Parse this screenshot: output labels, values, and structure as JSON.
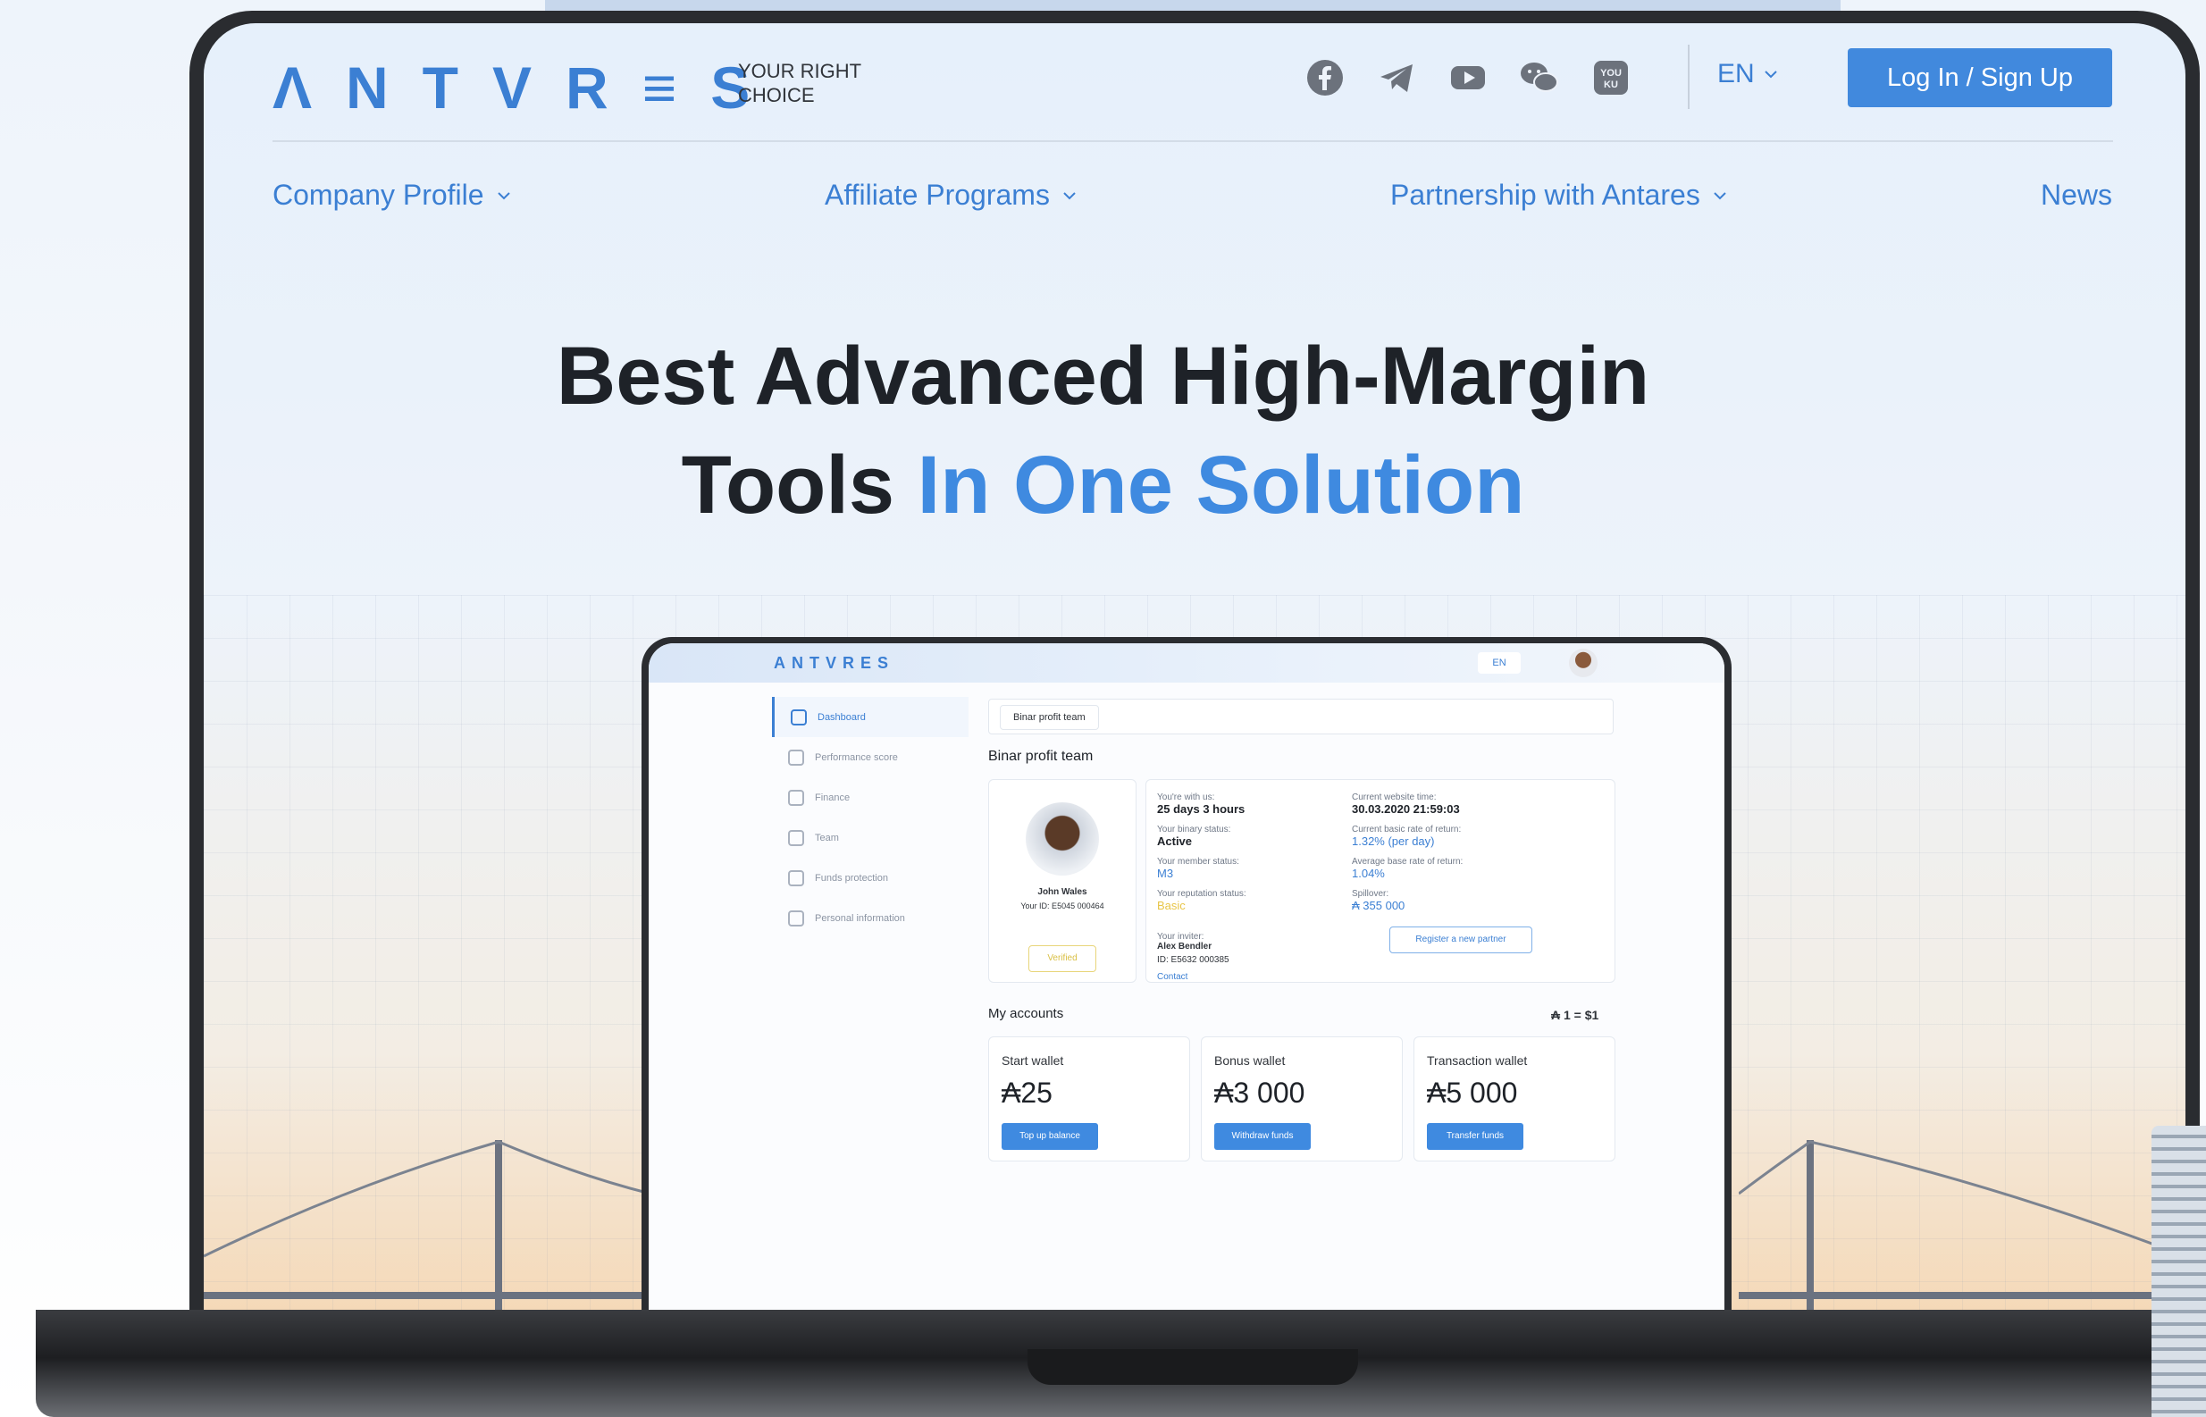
{
  "header": {
    "logo": "ΛNTVR≡S",
    "tagline": "YOUR RIGHT CHOICE",
    "social_icons": [
      "facebook-icon",
      "telegram-icon",
      "youtube-icon",
      "wechat-icon",
      "youku-icon"
    ],
    "language": "EN",
    "login_label": "Log In / Sign Up"
  },
  "nav": {
    "items": [
      {
        "label": "Company Profile",
        "has_dropdown": true
      },
      {
        "label": "Affiliate Programs",
        "has_dropdown": true
      },
      {
        "label": "Partnership with Antares",
        "has_dropdown": true
      },
      {
        "label": "News",
        "has_dropdown": false
      }
    ]
  },
  "hero": {
    "line1": "Best Advanced High-Margin",
    "line2_plain": "Tools",
    "line2_accent": "In One Solution"
  },
  "dashboard": {
    "logo": "ANTVRES",
    "language": "EN",
    "sidebar": [
      {
        "label": "Dashboard",
        "active": true
      },
      {
        "label": "Performance score"
      },
      {
        "label": "Finance"
      },
      {
        "label": "Team"
      },
      {
        "label": "Funds protection"
      },
      {
        "label": "Personal information"
      }
    ],
    "tab": "Binar profit team",
    "section_title": "Binar profit team",
    "profile": {
      "name": "John Wales",
      "id_line": "Your ID: E5045 000464",
      "badge": "Verified"
    },
    "stats_left": [
      {
        "label": "You're with us:",
        "value": "25 days 3 hours"
      },
      {
        "label": "Your binary status:",
        "value": "Active"
      },
      {
        "label": "Your member status:",
        "value": "M3"
      },
      {
        "label": "Your reputation status:",
        "value": "Basic"
      }
    ],
    "stats_right": [
      {
        "label": "Current website time:",
        "value": "30.03.2020 21:59:03"
      },
      {
        "label": "Current basic rate of return:",
        "value": "1.32% (per day)"
      },
      {
        "label": "Average base rate of return:",
        "value": "1.04%"
      },
      {
        "label": "Spillover:",
        "value": "₳ 355 000"
      }
    ],
    "inviter": {
      "label": "Your inviter:",
      "name": "Alex Bendler",
      "id": "ID: E5632 000385",
      "contact": "Contact"
    },
    "register_button": "Register a new partner",
    "accounts_title": "My accounts",
    "rate": "₳ 1 = $1",
    "wallets": [
      {
        "title": "Start wallet",
        "value": "₳25",
        "button": "Top up balance"
      },
      {
        "title": "Bonus wallet",
        "value": "₳3 000",
        "button": "Withdraw funds"
      },
      {
        "title": "Transaction wallet",
        "value": "₳5 000",
        "button": "Transfer funds"
      }
    ]
  },
  "colors": {
    "accent": "#3f8ae0",
    "text_dark": "#1e2228",
    "laptop": "#2a2c30"
  }
}
